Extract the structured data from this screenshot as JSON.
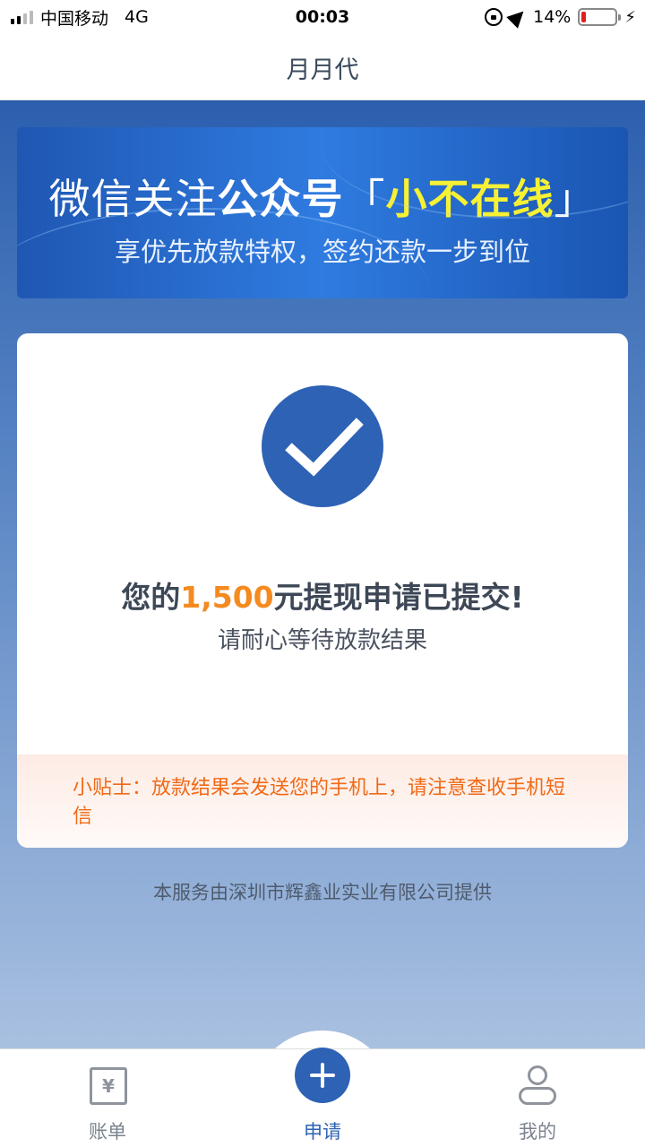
{
  "status_bar": {
    "carrier": "中国移动",
    "network": "4G",
    "time": "00:03",
    "battery": "14%",
    "battery_level": 0.14
  },
  "nav": {
    "title": "月月代"
  },
  "banner": {
    "prefix": "微信关注",
    "bold": "公众号",
    "bracket_open": "「",
    "highlight": "小不在线",
    "bracket_close": "」",
    "subtitle": "享优先放款特权，签约还款一步到位"
  },
  "result": {
    "title_prefix": "您的",
    "amount": "1,500",
    "title_suffix": "元提现申请已提交!",
    "subtitle": "请耐心等待放款结果",
    "tip": "小贴士：放款结果会发送您的手机上，请注意查收手机短信"
  },
  "footer": {
    "provider": "本服务由深圳市辉鑫业实业有限公司提供"
  },
  "tabs": {
    "bill": "账单",
    "bill_icon_glyph": "¥",
    "apply": "申请",
    "mine": "我的"
  },
  "colors": {
    "primary": "#2d62b5",
    "amount": "#f58a1f",
    "tip": "#f06a17",
    "banner_highlight": "#f6f134"
  }
}
